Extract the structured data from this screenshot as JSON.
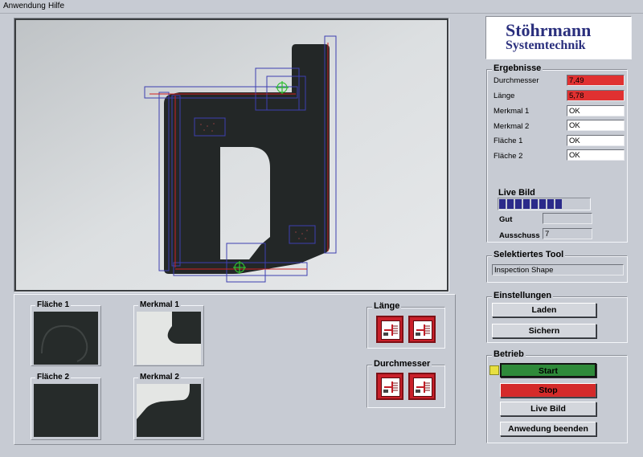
{
  "menu": [
    "Anwendung",
    "Hilfe"
  ],
  "logo": {
    "line1": "Stöhrmann",
    "line2": "Systemtechnik",
    "color": "#2a2f7d"
  },
  "results": {
    "title": "Ergebnisse",
    "rows": [
      {
        "label": "Durchmesser",
        "value": "7,49",
        "status": "bad"
      },
      {
        "label": "Länge",
        "value": "5,78",
        "status": "bad"
      },
      {
        "label": "Merkmal 1",
        "value": "OK",
        "status": "ok"
      },
      {
        "label": "Merkmal 2",
        "value": "OK",
        "status": "ok"
      },
      {
        "label": "Fläche 1",
        "value": "OK",
        "status": "ok"
      },
      {
        "label": "Fläche 2",
        "value": "OK",
        "status": "ok"
      }
    ],
    "live_label": "Live Bild",
    "live_progress": 0.72,
    "gut_label": "Gut",
    "gut_value": "",
    "ausschuss_label": "Ausschuss",
    "ausschuss_value": "7"
  },
  "selected_tool": {
    "title": "Selektiertes Tool",
    "value": "Inspection Shape"
  },
  "settings": {
    "title": "Einstellungen",
    "load": "Laden",
    "save": "Sichern"
  },
  "operation": {
    "title": "Betrieb",
    "start": "Start",
    "stop": "Stop",
    "live": "Live Bild",
    "quit": "Anwedung beenden"
  },
  "thumbs": {
    "flaeche1": "Fläche 1",
    "merkmal1": "Merkmal 1",
    "flaeche2": "Fläche 2",
    "merkmal2": "Merkmal 2"
  },
  "tool_groups": {
    "laenge": "Länge",
    "durchmesser": "Durchmesser"
  },
  "colors": {
    "bad": "#e03131",
    "ok": "#ffffff",
    "start": "#2f8a3a",
    "stop": "#d42a2a",
    "progress": "#2b2a8a",
    "indicator": "#e8e040"
  }
}
